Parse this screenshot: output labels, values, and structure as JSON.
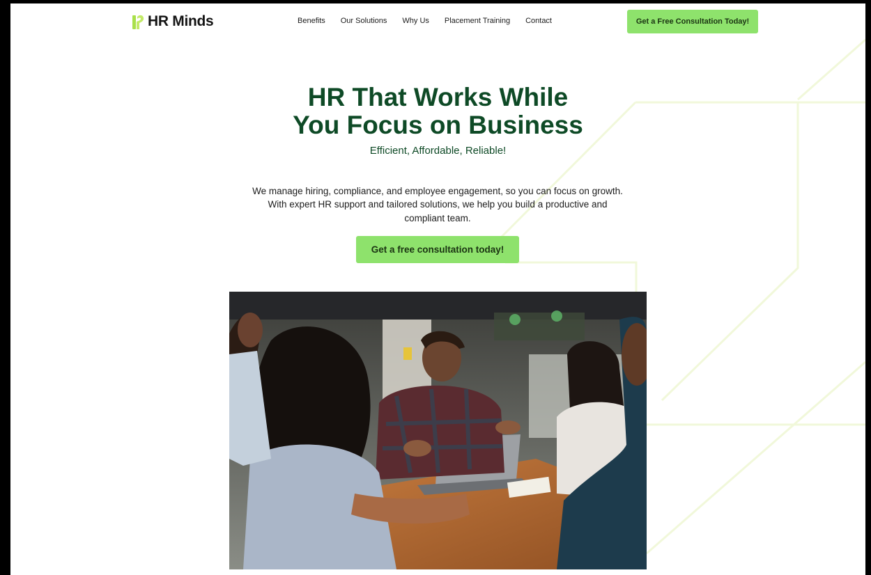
{
  "brand": {
    "name": "HR Minds",
    "logo_icon": "hr-minds-logo-mark",
    "accent": "#8ee26c",
    "heading_color": "#0e4a26"
  },
  "nav": {
    "items": [
      "Benefits",
      "Our Solutions",
      "Why Us",
      "Placement Training",
      "Contact"
    ]
  },
  "header": {
    "cta_label": "Get a Free Consultation Today!"
  },
  "hero": {
    "title_line1": "HR That Works While",
    "title_line2": "You Focus on Business",
    "subtitle": "Efficient, Affordable, Reliable!",
    "description": "We manage hiring, compliance, and employee engagement, so you can focus on growth. With expert HR support and tailored solutions, we help you build a productive and compliant team.",
    "cta_label": "Get a free consultation today!"
  },
  "image": {
    "subject": "team-meeting-photo"
  }
}
